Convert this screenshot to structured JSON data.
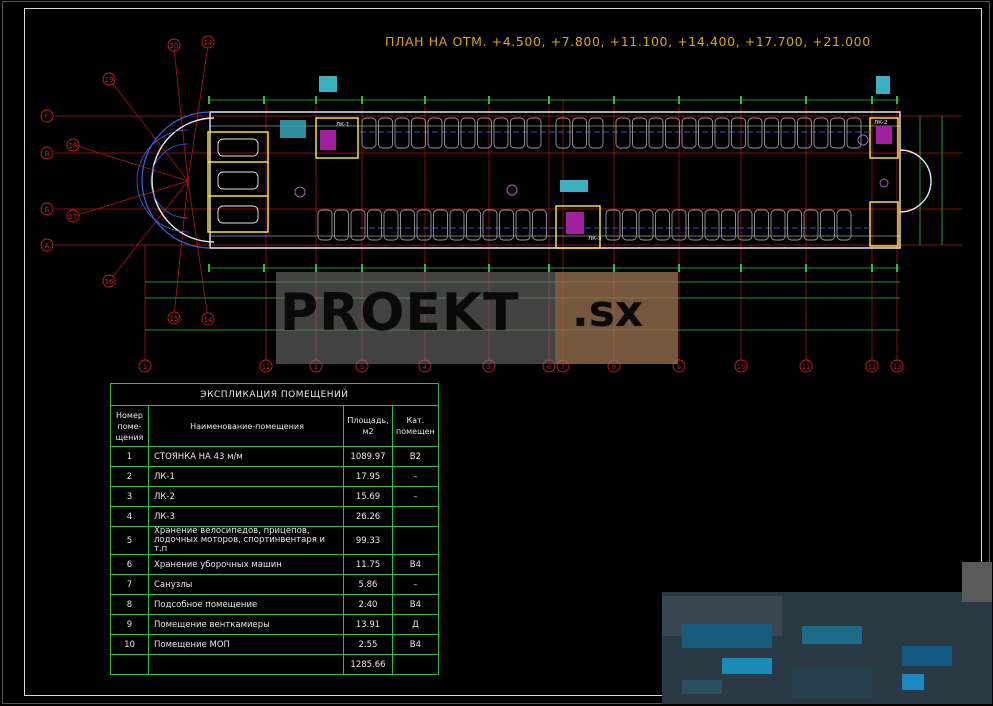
{
  "plan_title": "ПЛАН НА ОТМ. +4.500, +7.800, +11.100, +14.400, +17.700, +21.000",
  "axes_top": [
    "20",
    "14"
  ],
  "axes_left": [
    "Г",
    "В",
    "Б",
    "А"
  ],
  "axes_radial": [
    "19",
    "18",
    "17",
    "16",
    "15",
    "14"
  ],
  "axes_bottom": [
    "1",
    "12",
    "2",
    "3",
    "4",
    "5",
    "6",
    "7",
    "8",
    "9",
    "10",
    "11",
    "12",
    "13"
  ],
  "room_tags": [
    "ЛК-1",
    "ЛК-2",
    "ЛК-3"
  ],
  "watermark": {
    "main": "PROEKT",
    "suffix": ".sx"
  },
  "explication": {
    "caption": "ЭКСПЛИКАЦИЯ ПОМЕЩЕНИЙ",
    "headers": {
      "number": "Номер поме-щения",
      "name": "Наименование-помещения",
      "area": "Площадь, м2",
      "category": "Кат. помещен"
    },
    "rows": [
      {
        "num": "1",
        "name": "СТОЯНКА НА 43 м/м",
        "area": "1089.97",
        "cat": "В2"
      },
      {
        "num": "2",
        "name": "ЛК-1",
        "area": "17.95",
        "cat": "–"
      },
      {
        "num": "3",
        "name": "ЛК-2",
        "area": "15.69",
        "cat": "–"
      },
      {
        "num": "4",
        "name": "ЛК-3",
        "area": "26.26",
        "cat": ""
      },
      {
        "num": "5",
        "name": "Хранение велосипедов, прицепов, лодочных моторов, спортинвентаря и т.п",
        "area": "99.33",
        "cat": ""
      },
      {
        "num": "6",
        "name": "Хранение уборочных машин",
        "area": "11.75",
        "cat": "В4"
      },
      {
        "num": "7",
        "name": "Санузлы",
        "area": "5.86",
        "cat": "–"
      },
      {
        "num": "8",
        "name": "Подсобное помещение",
        "area": "2.40",
        "cat": "В4"
      },
      {
        "num": "9",
        "name": "Помещение вентками­еры",
        "area": "13.91",
        "cat": "Д"
      },
      {
        "num": "10",
        "name": "Помещение МОП",
        "area": "2.55",
        "cat": "В4"
      }
    ],
    "total": "1285.66"
  },
  "colors": {
    "background": "#000000",
    "title": "#d9a520",
    "axis": "#cc2222",
    "dimension": "#2fbf3f",
    "wall": "#f0e040",
    "parking": "#9a9a9a",
    "stair": "#c040c0",
    "table_border": "#2fbf3f"
  }
}
